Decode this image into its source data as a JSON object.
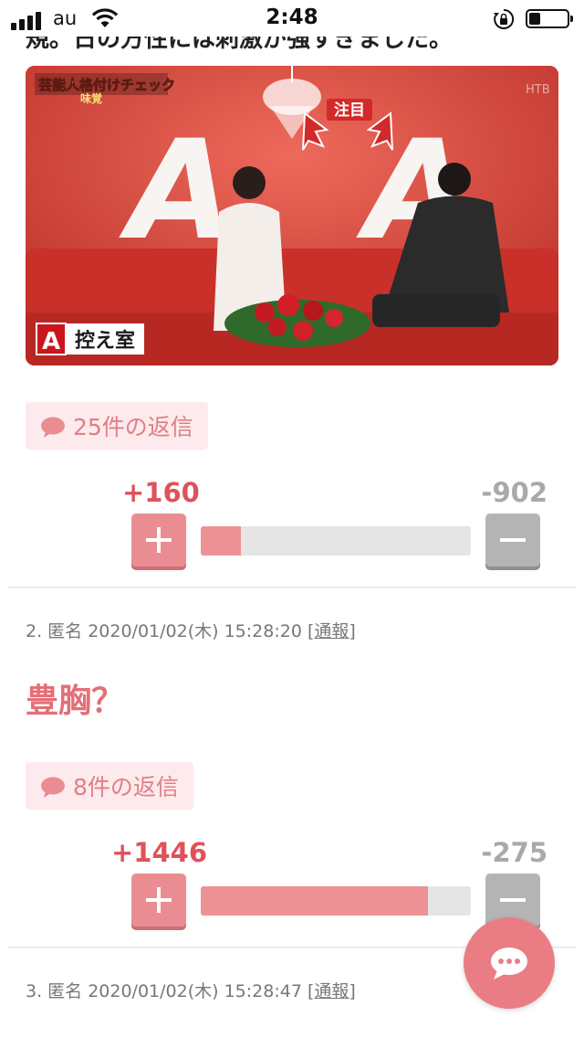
{
  "status_bar": {
    "carrier": "au",
    "time": "2:48"
  },
  "top_cut_text": "規。日の方性には刺激が強すぎました。",
  "image": {
    "program_caption": "芸能人格付けチェック",
    "category_caption": "味覚",
    "callout_label": "注目",
    "room_big_letter": "A",
    "room_label_letter": "A",
    "room_label": "控え室",
    "channel_logo": "HTB"
  },
  "comments": [
    {
      "replies_label": "25件の返信",
      "plus_votes": "+160",
      "minus_votes": "-902",
      "plus_ratio": 0.15
    },
    {
      "meta_prefix": "2. 匿名 2020/01/02(木) 15:28:20 [",
      "report_label": "通報",
      "meta_suffix": "]",
      "body": "豊胸？",
      "replies_label": "8件の返信",
      "plus_votes": "+1446",
      "minus_votes": "-275",
      "plus_ratio": 0.84
    },
    {
      "meta_prefix": "3. 匿名 2020/01/02(木) 15:28:47 [",
      "report_label": "通報",
      "meta_suffix": "]"
    }
  ],
  "colors": {
    "accent": "#e36f77",
    "plus_button": "#ea8d93",
    "minus_button": "#b4b4b4",
    "reply_bg": "#fdeaec"
  },
  "icons": [
    "signal-icon",
    "wifi-icon",
    "rotation-lock-icon",
    "battery-icon",
    "speech-bubble-icon",
    "plus-icon",
    "minus-icon",
    "chat-icon"
  ]
}
